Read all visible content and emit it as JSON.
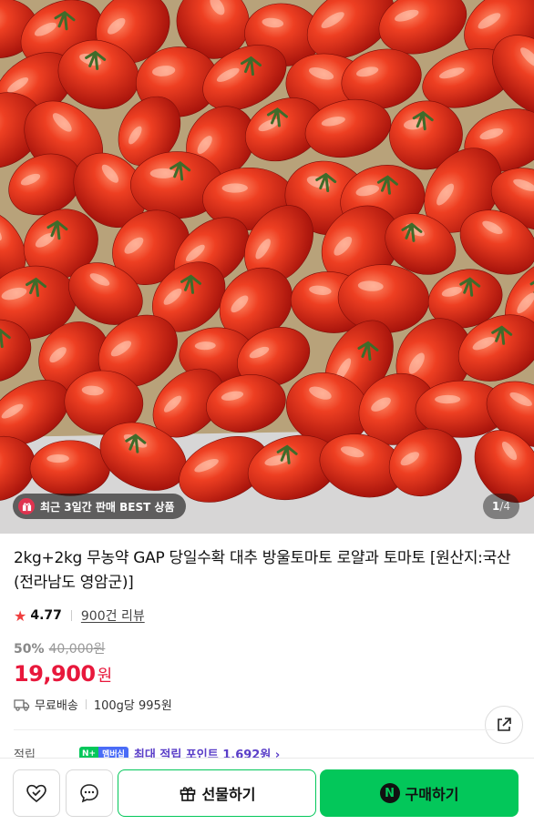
{
  "hero": {
    "badge_text": "최근 3일간 판매 BEST 상품",
    "pager_current": "1",
    "pager_total": "/4"
  },
  "product": {
    "title": "2kg+2kg 무농약 GAP 당일수확 대추 방울토마토 로얄과 토마토 [원산지:국산(전라남도 영암군)]",
    "rating": "4.77",
    "reviews": "900건 리뷰",
    "discount": "50%",
    "original_price": "40,000원",
    "price": "19,900",
    "currency": "원",
    "shipping": "무료배송",
    "unit_price": "100g당 995원"
  },
  "points": {
    "label": "적립",
    "badge_n": "N+",
    "badge_m": "멤버십",
    "text": "최대 적립 포인트 1,692원 ›"
  },
  "bottom_bar": {
    "gift_label": "선물하기",
    "buy_label": "구매하기",
    "npay_letter": "N"
  },
  "colors": {
    "accent_green": "#03c75a",
    "price_red": "#e8183c",
    "points_purple": "#5a3ec8"
  }
}
